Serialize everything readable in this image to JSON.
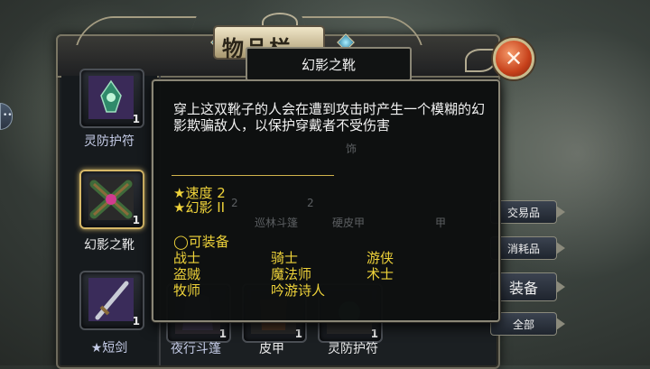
{
  "side_tab": {
    "label": "••"
  },
  "panel": {
    "title": "物品栏"
  },
  "tooltip": {
    "item_name": "幻影之靴",
    "description": "穿上这双靴子的人会在遭到攻击时产生一个模糊的幻影欺骗敌人，以保护穿戴者不受伤害",
    "stats": [
      "★速度 2",
      "★幻影 II"
    ],
    "equip_header": "◯可装备",
    "classes": [
      "战士",
      "骑士",
      "游侠",
      "盗贼",
      "魔法师",
      "术士",
      "牧师",
      "吟游诗人"
    ],
    "faded_labels": [
      "饰",
      "巡林斗篷",
      "硬皮甲",
      "甲",
      "2",
      "2"
    ]
  },
  "left_items": [
    {
      "label": "灵防护符",
      "count": "1"
    },
    {
      "label": "幻影之靴",
      "count": "1"
    },
    {
      "label": "★短剑",
      "count": "1"
    }
  ],
  "bottom_items": [
    {
      "label": "夜行斗篷",
      "count": "1"
    },
    {
      "label": "皮甲",
      "count": "1"
    },
    {
      "label": "灵防护符",
      "count": "1"
    }
  ],
  "right_buttons": [
    "交易品",
    "消耗品",
    "装备",
    "全部"
  ],
  "close": {
    "symbol": "✕"
  },
  "colors": {
    "gold_text": "#efd33a",
    "accent_border": "#d7b968",
    "close_red": "#c6401a"
  }
}
